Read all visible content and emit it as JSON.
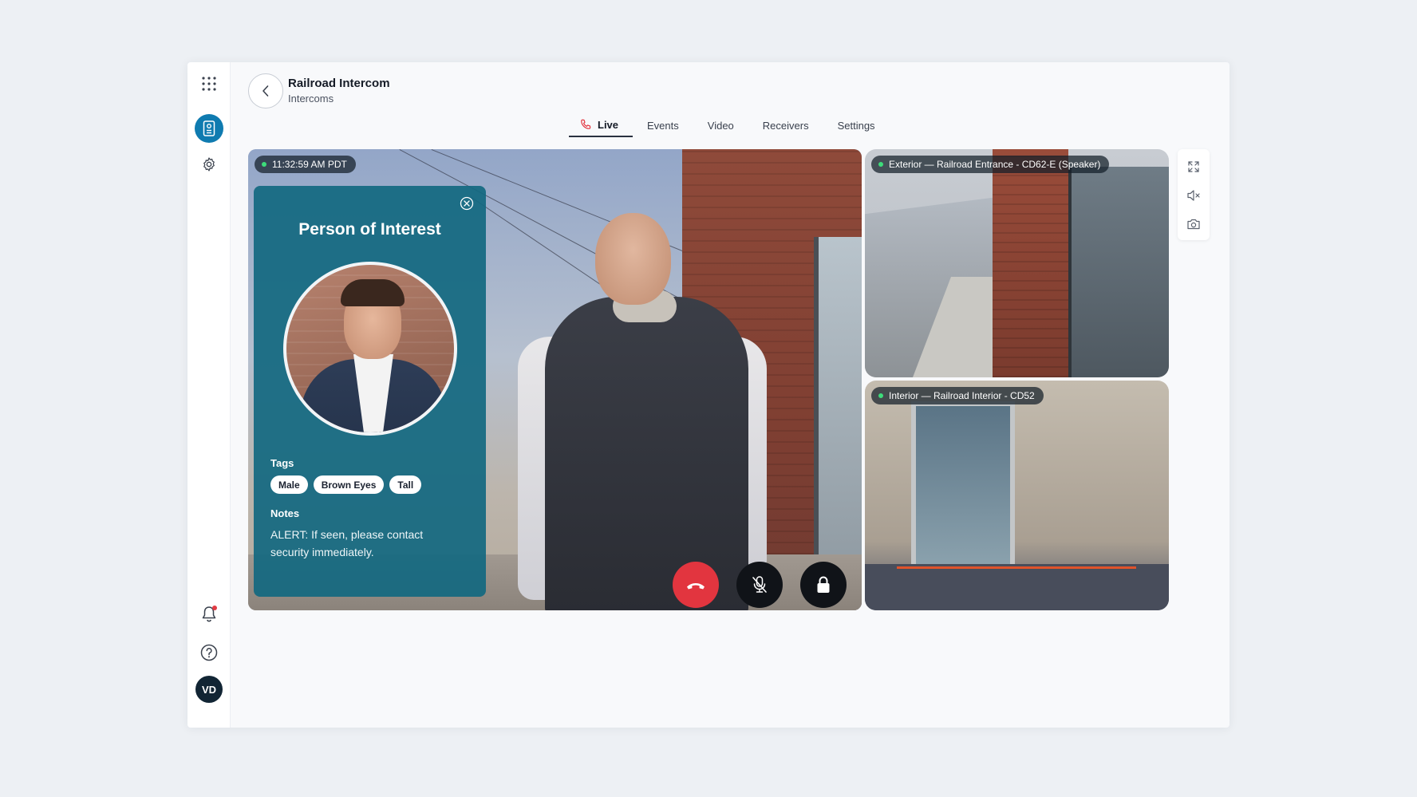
{
  "header": {
    "title": "Railroad Intercom",
    "subtitle": "Intercoms"
  },
  "tabs": [
    {
      "label": "Live",
      "active": true
    },
    {
      "label": "Events",
      "active": false
    },
    {
      "label": "Video",
      "active": false
    },
    {
      "label": "Receivers",
      "active": false
    },
    {
      "label": "Settings",
      "active": false
    }
  ],
  "sidebar": {
    "items": [
      {
        "icon": "apps-grid-icon"
      },
      {
        "icon": "intercom-icon",
        "active": true
      },
      {
        "icon": "gear-icon"
      },
      {
        "icon": "bell-icon",
        "has_notification": true
      },
      {
        "icon": "help-icon"
      }
    ],
    "avatar_initials": "VD"
  },
  "main_feed": {
    "timestamp": "11:32:59 AM PDT"
  },
  "poi": {
    "title": "Person of Interest",
    "tags_label": "Tags",
    "tags": [
      "Male",
      "Brown Eyes",
      "Tall"
    ],
    "notes_label": "Notes",
    "notes": "ALERT: If seen, please contact security immediately."
  },
  "feeds": [
    {
      "label": "Exterior — Railroad Entrance - CD62-E (Speaker)"
    },
    {
      "label": "Interior — Railroad Interior - CD52"
    }
  ],
  "colors": {
    "accent": "#0f7bb0",
    "hangup": "#e2353f",
    "poi_card": "#126880",
    "live_indicator": "#3ddc7a"
  }
}
